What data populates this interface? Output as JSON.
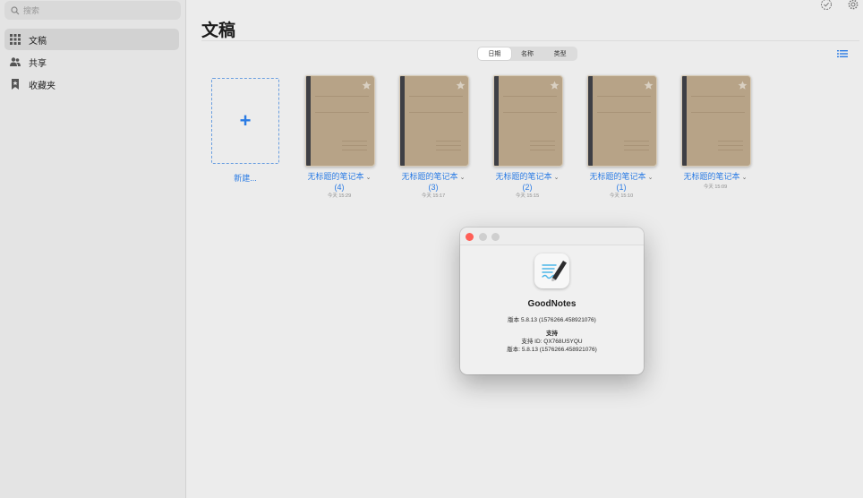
{
  "sidebar": {
    "search_placeholder": "搜索",
    "items": [
      {
        "label": "文稿",
        "icon": "grid-icon",
        "active": true
      },
      {
        "label": "共享",
        "icon": "people-icon",
        "active": false
      },
      {
        "label": "收藏夹",
        "icon": "bookmark-star-icon",
        "active": false
      }
    ]
  },
  "main": {
    "title": "文稿",
    "sort_options": [
      "日期",
      "名称",
      "类型"
    ],
    "sort_selected": "日期",
    "new_label": "新建...",
    "documents": [
      {
        "title": "无标题的笔记本",
        "suffix": "(4)",
        "time": "今天 15:29"
      },
      {
        "title": "无标题的笔记本",
        "suffix": "(3)",
        "time": "今天 15:17"
      },
      {
        "title": "无标题的笔记本",
        "suffix": "(2)",
        "time": "今天 15:15"
      },
      {
        "title": "无标题的笔记本",
        "suffix": "(1)",
        "time": "今天 15:10"
      },
      {
        "title": "无标题的笔记本",
        "suffix": "",
        "time": "今天 15:09"
      }
    ]
  },
  "about": {
    "app_name": "GoodNotes",
    "version_line": "版本 5.8.13 (1576266.458921076)",
    "support_heading": "支持",
    "support_id": "支持 ID: QX768USYQU",
    "support_version": "版本: 5.8.13 (1576266.458921076)",
    "colors": {
      "close": "#ff5f57",
      "inactive": "#cfcfcf"
    }
  },
  "colors": {
    "accent": "#2a7be4",
    "cover": "#b7a387",
    "spine": "#3e3f45"
  }
}
